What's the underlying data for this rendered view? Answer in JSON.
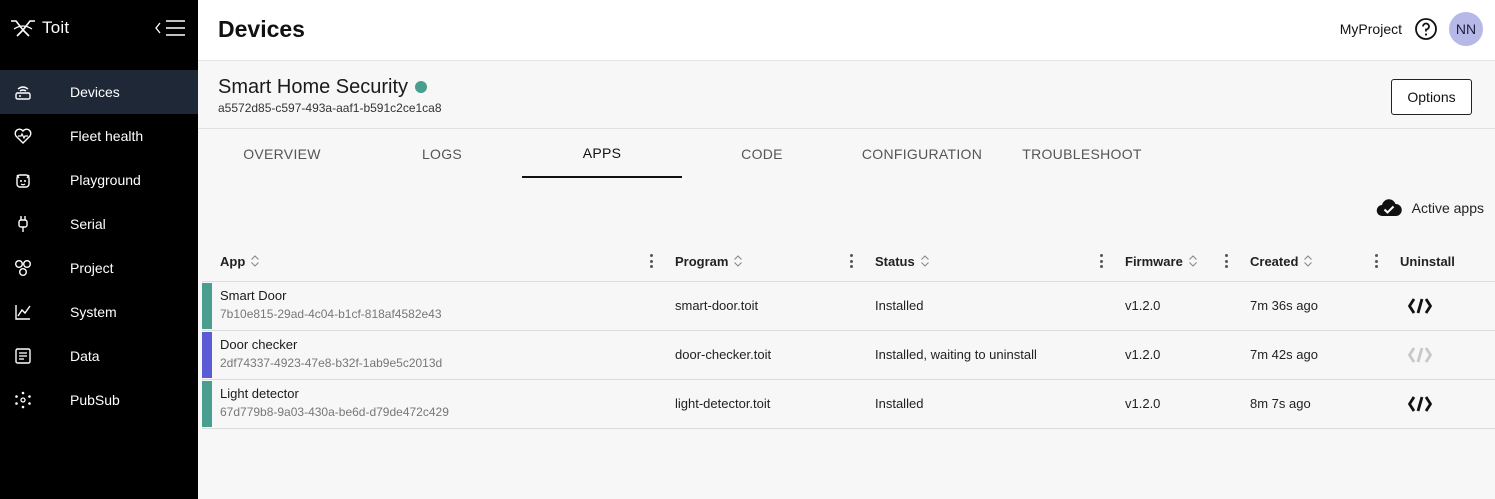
{
  "sidebar": {
    "brand": "Toit",
    "items": [
      {
        "label": "Devices",
        "icon": "router-icon",
        "active": true
      },
      {
        "label": "Fleet health",
        "icon": "heart-pulse-icon",
        "active": false
      },
      {
        "label": "Playground",
        "icon": "cat-face-icon",
        "active": false
      },
      {
        "label": "Serial",
        "icon": "usb-plug-icon",
        "active": false
      },
      {
        "label": "Project",
        "icon": "project-circles-icon",
        "active": false
      },
      {
        "label": "System",
        "icon": "line-chart-icon",
        "active": false
      },
      {
        "label": "Data",
        "icon": "document-list-icon",
        "active": false
      },
      {
        "label": "PubSub",
        "icon": "hub-network-icon",
        "active": false
      }
    ]
  },
  "header": {
    "title": "Devices",
    "project": "MyProject",
    "avatar_initials": "NN"
  },
  "device": {
    "name": "Smart Home Security",
    "id": "a5572d85-c597-493a-aaf1-b591c2ce1ca8",
    "status_color": "#4a9e8f",
    "options_label": "Options"
  },
  "tabs": [
    {
      "label": "OVERVIEW",
      "active": false
    },
    {
      "label": "LOGS",
      "active": false
    },
    {
      "label": "APPS",
      "active": true
    },
    {
      "label": "CODE",
      "active": false
    },
    {
      "label": "CONFIGURATION",
      "active": false
    },
    {
      "label": "TROUBLESHOOT",
      "active": false
    }
  ],
  "active_apps_label": "Active apps",
  "table": {
    "columns": [
      "App",
      "Program",
      "Status",
      "Firmware",
      "Created",
      "Uninstall"
    ],
    "rows": [
      {
        "name": "Smart Door",
        "id": "7b10e815-29ad-4c04-b1cf-818af4582e43",
        "program": "smart-door.toit",
        "status": "Installed",
        "firmware": "v1.2.0",
        "created": "7m 36s ago",
        "bar_color": "#4a9e8f",
        "uninstall_enabled": true
      },
      {
        "name": "Door checker",
        "id": "2df74337-4923-47e8-b32f-1ab9e5c2013d",
        "program": "door-checker.toit",
        "status": "Installed, waiting to uninstall",
        "firmware": "v1.2.0",
        "created": "7m 42s ago",
        "bar_color": "#5b5bd6",
        "uninstall_enabled": false
      },
      {
        "name": "Light detector",
        "id": "67d779b8-9a03-430a-be6d-d79de472c429",
        "program": "light-detector.toit",
        "status": "Installed",
        "firmware": "v1.2.0",
        "created": "8m 7s ago",
        "bar_color": "#4a9e8f",
        "uninstall_enabled": true
      }
    ]
  }
}
